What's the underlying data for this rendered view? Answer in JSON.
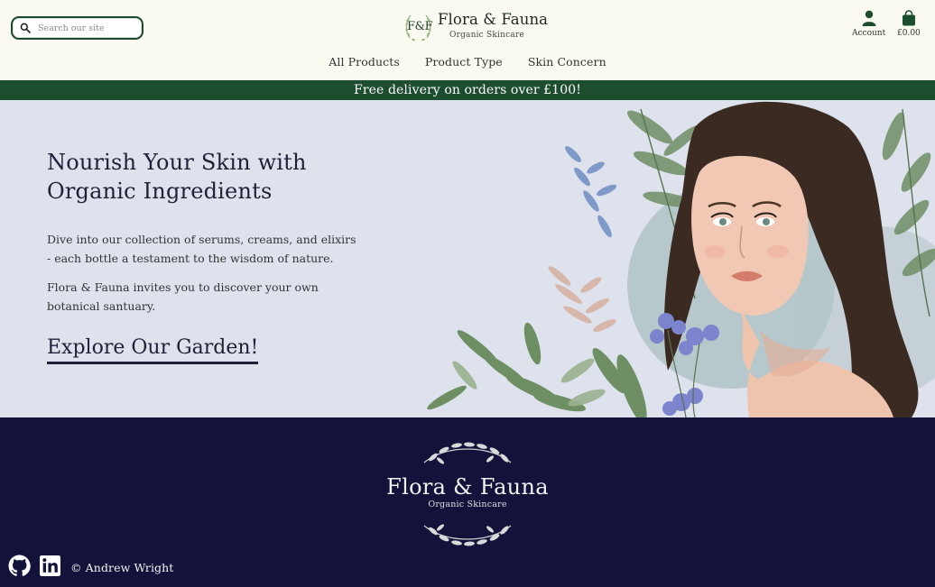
{
  "header": {
    "search": {
      "placeholder": "Search our site",
      "value": ""
    },
    "brand": {
      "monogram": "F&F",
      "name": "Flora & Fauna",
      "tagline": "Organic Skincare"
    },
    "nav": [
      {
        "label": "All Products"
      },
      {
        "label": "Product Type"
      },
      {
        "label": "Skin Concern"
      }
    ],
    "account_label": "Account",
    "cart_total": "£0.00"
  },
  "banner": {
    "text": "Free delivery on orders over £100!"
  },
  "hero": {
    "title": "Nourish Your Skin with Organic Ingredients",
    "paragraph1": "Dive into our collection of serums, creams, and elixirs - each bottle a testament to the wisdom of nature.",
    "paragraph2": "Flora & Fauna invites you to discover your own botanical santuary.",
    "cta": "Explore Our Garden!"
  },
  "footer": {
    "brand_name": "Flora & Fauna",
    "tagline": "Organic Skincare",
    "copyright": "© Andrew Wright"
  },
  "colors": {
    "header_bg": "#fbfaf1",
    "accent_green": "#1d4d2f",
    "hero_bg": "#dde2ec",
    "footer_bg": "#12123a",
    "heading_navy": "#1e2138"
  },
  "icons": [
    "search-icon",
    "account-icon",
    "shopping-bag-icon",
    "github-icon",
    "linkedin-icon",
    "laurel-wreath-icon"
  ]
}
